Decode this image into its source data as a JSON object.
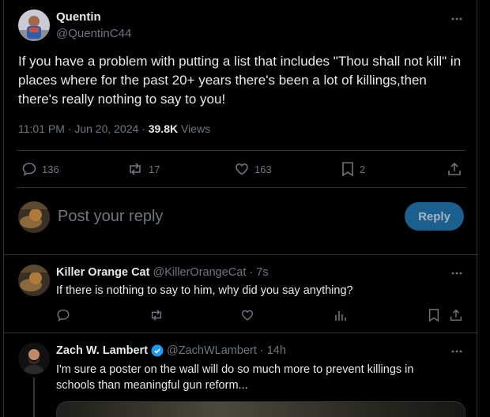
{
  "main_tweet": {
    "author_name": "Quentin",
    "handle": "@QuentinC44",
    "text": "If you have a problem with putting a list that includes \"Thou shall not kill\" in places where for the past 20+ years there's been a lot of killings,then there's really nothing to say to you!",
    "time": "11:01 PM · Jun 20, 2024 · ",
    "views_count": "39.8K",
    "views_label": " Views",
    "replies": "136",
    "reposts": "17",
    "likes": "163",
    "bookmarks": "2"
  },
  "composer": {
    "placeholder": "Post your reply",
    "reply_label": "Reply"
  },
  "replies": [
    {
      "author_name": "Killer Orange Cat",
      "handle": "@KillerOrangeCat",
      "time": "· 7s",
      "text": "If there is nothing to say to him, why did you say anything?"
    },
    {
      "author_name": "Zach W. Lambert",
      "handle": "@ZachWLambert",
      "time": "· 14h",
      "text": "I'm sure a poster on the wall will do so much more to prevent killings in schools than meaningful gun reform..."
    }
  ],
  "colors": {
    "background": "#000000",
    "text": "#e7e9ea",
    "muted": "#71767b",
    "accent": "#1d9bf0",
    "reply_button": "#1a5f8e"
  }
}
